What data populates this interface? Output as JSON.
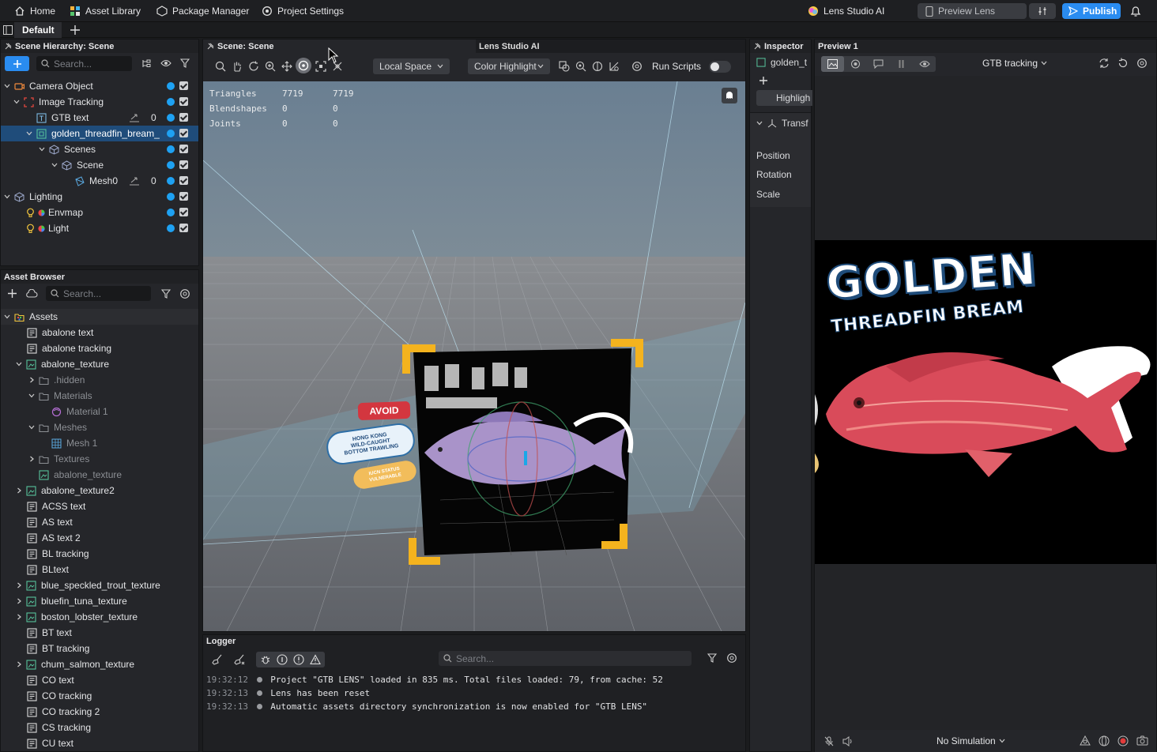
{
  "topbar": {
    "home": "Home",
    "asset_library": "Asset Library",
    "package_manager": "Package Manager",
    "project_settings": "Project Settings",
    "lens_studio_ai": "Lens Studio AI",
    "preview_lens": "Preview Lens",
    "publish": "Publish"
  },
  "tabs": {
    "default": "Default"
  },
  "hierarchy": {
    "title": "Scene Hierarchy: Scene",
    "search_placeholder": "Search...",
    "items": [
      {
        "label": "Camera Object"
      },
      {
        "label": "Image Tracking"
      },
      {
        "label": "GTB text",
        "count": "0"
      },
      {
        "label": "golden_threadfin_bream_"
      },
      {
        "label": "Scenes"
      },
      {
        "label": "Scene"
      },
      {
        "label": "Mesh0",
        "count": "0"
      },
      {
        "label": "Lighting"
      },
      {
        "label": "Envmap"
      },
      {
        "label": "Light"
      }
    ]
  },
  "assets": {
    "title": "Asset Browser",
    "search_placeholder": "Search...",
    "items": [
      {
        "label": "Assets"
      },
      {
        "label": "abalone text"
      },
      {
        "label": "abalone tracking"
      },
      {
        "label": "abalone_texture"
      },
      {
        "label": ".hidden"
      },
      {
        "label": "Materials"
      },
      {
        "label": "Material 1"
      },
      {
        "label": "Meshes"
      },
      {
        "label": "Mesh 1"
      },
      {
        "label": "Textures"
      },
      {
        "label": "abalone_texture"
      },
      {
        "label": "abalone_texture2"
      },
      {
        "label": "ACSS text"
      },
      {
        "label": "AS text"
      },
      {
        "label": "AS text 2"
      },
      {
        "label": "BL tracking"
      },
      {
        "label": "BLtext"
      },
      {
        "label": "blue_speckled_trout_texture"
      },
      {
        "label": "bluefin_tuna_texture"
      },
      {
        "label": "boston_lobster_texture"
      },
      {
        "label": "BT text"
      },
      {
        "label": "BT tracking"
      },
      {
        "label": "chum_salmon_texture"
      },
      {
        "label": "CO text"
      },
      {
        "label": "CO tracking"
      },
      {
        "label": "CO tracking 2"
      },
      {
        "label": "CS tracking"
      },
      {
        "label": "CU text"
      }
    ]
  },
  "scene": {
    "title": "Scene: Scene",
    "ai_tab": "Lens Studio AI",
    "space_dropdown": "Local Space",
    "highlight_dropdown": "Color Highlight",
    "run_scripts": "Run Scripts",
    "stats": [
      {
        "label": "Triangles",
        "a": "7719",
        "b": "7719"
      },
      {
        "label": "Blendshapes",
        "a": "0",
        "b": "0"
      },
      {
        "label": "Joints",
        "a": "0",
        "b": "0"
      }
    ],
    "badges": {
      "avoid": "AVOID",
      "hk1": "HONG KONG",
      "hk2": "WILD-CAUGHT",
      "hk3": "BOTTOM TRAWLING",
      "iucn1": "IUCN STATUS",
      "iucn2": "VULNERABLE"
    }
  },
  "logger": {
    "title": "Logger",
    "search_placeholder": "Search...",
    "lines": [
      {
        "time": "19:32:12",
        "msg": "Project \"GTB LENS\" loaded in 835 ms. Total files loaded: 79, from cache: 52"
      },
      {
        "time": "19:32:13",
        "msg": "Lens has been reset"
      },
      {
        "time": "19:32:13",
        "msg": "Automatic assets directory synchronization is now enabled for \"GTB LENS\""
      }
    ]
  },
  "inspector": {
    "title": "Inspector",
    "object_name": "golden_t",
    "highlight_btn": "Highligh",
    "transform": "Transf",
    "position": "Position",
    "rotation": "Rotation",
    "scale": "Scale"
  },
  "preview": {
    "title": "Preview 1",
    "tracking_dropdown": "GTB tracking",
    "title_line1": "GOLDEN",
    "title_line2": "THREADFIN BREAM",
    "simulation": "No Simulation"
  },
  "colors": {
    "accent": "#2a8cf0",
    "selection": "#1f4c7a",
    "visible_dot": "#1ea1f2"
  }
}
